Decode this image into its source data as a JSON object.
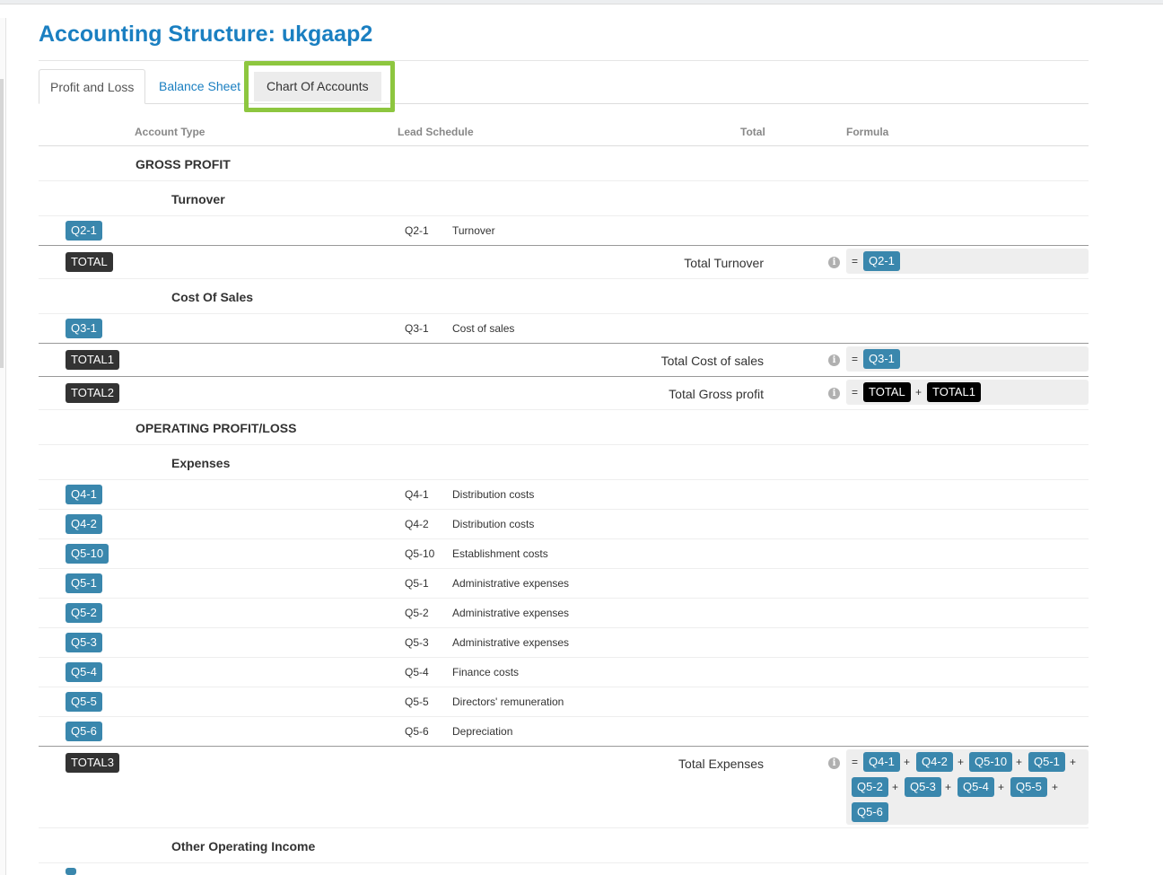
{
  "page": {
    "title": "Accounting Structure: ukgaap2"
  },
  "tabs": [
    {
      "label": "Profit and Loss",
      "state": "active"
    },
    {
      "label": "Balance Sheet",
      "state": "link"
    },
    {
      "label": "Chart Of Accounts",
      "state": "highlighted"
    }
  ],
  "table": {
    "headers": {
      "account_type": "Account Type",
      "lead_schedule": "Lead Schedule",
      "total": "Total",
      "formula": "Formula"
    },
    "groups": {
      "gross_profit": "GROSS PROFIT",
      "turnover": "Turnover",
      "cost_of_sales": "Cost Of Sales",
      "operating": "OPERATING PROFIT/LOSS",
      "expenses": "Expenses",
      "other_income": "Other Operating Income"
    },
    "rows": {
      "q21": {
        "badge": "Q2-1",
        "code": "Q2-1",
        "desc": "Turnover"
      },
      "q31": {
        "badge": "Q3-1",
        "code": "Q3-1",
        "desc": "Cost of sales"
      },
      "q41": {
        "badge": "Q4-1",
        "code": "Q4-1",
        "desc": "Distribution costs"
      },
      "q42": {
        "badge": "Q4-2",
        "code": "Q4-2",
        "desc": "Distribution costs"
      },
      "q510": {
        "badge": "Q5-10",
        "code": "Q5-10",
        "desc": "Establishment costs"
      },
      "q51": {
        "badge": "Q5-1",
        "code": "Q5-1",
        "desc": "Administrative expenses"
      },
      "q52": {
        "badge": "Q5-2",
        "code": "Q5-2",
        "desc": "Administrative expenses"
      },
      "q53": {
        "badge": "Q5-3",
        "code": "Q5-3",
        "desc": "Administrative expenses"
      },
      "q54": {
        "badge": "Q5-4",
        "code": "Q5-4",
        "desc": "Finance costs"
      },
      "q55": {
        "badge": "Q5-5",
        "code": "Q5-5",
        "desc": "Directors' remuneration"
      },
      "q56": {
        "badge": "Q5-6",
        "code": "Q5-6",
        "desc": "Depreciation"
      }
    },
    "totals": {
      "total": {
        "badge": "TOTAL",
        "label": "Total Turnover",
        "formula": [
          "Q2-1"
        ]
      },
      "total1": {
        "badge": "TOTAL1",
        "label": "Total Cost of sales",
        "formula": [
          "Q3-1"
        ]
      },
      "total2": {
        "badge": "TOTAL2",
        "label": "Total Gross profit",
        "formula": [
          "TOTAL",
          "TOTAL1"
        ]
      },
      "total3": {
        "badge": "TOTAL3",
        "label": "Total Expenses",
        "formula": [
          "Q4-1",
          "Q4-2",
          "Q5-10",
          "Q5-1",
          "Q5-2",
          "Q5-3",
          "Q5-4",
          "Q5-5",
          "Q5-6"
        ]
      }
    },
    "symbols": {
      "equals": "=",
      "plus": "+",
      "info": "i"
    }
  },
  "colors": {
    "title": "#1a7fc1",
    "badge_blue": "#3a87ad",
    "badge_dark": "#333333",
    "highlight": "#8dc63f"
  }
}
